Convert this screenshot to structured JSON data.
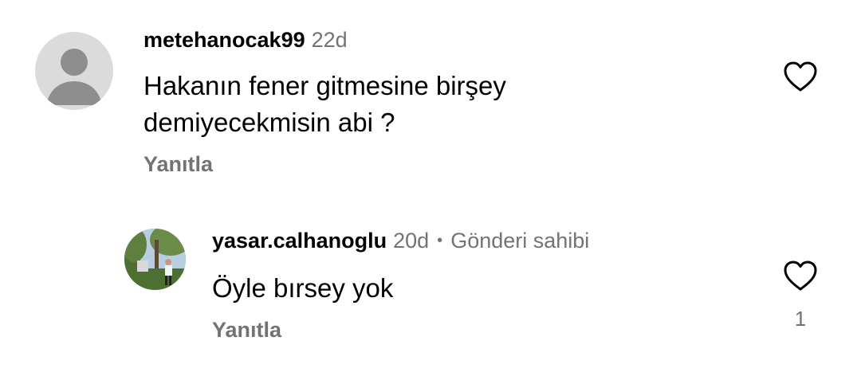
{
  "comments": [
    {
      "username": "metehanocak99",
      "age": "22d",
      "text_lines": [
        "Hakanın fener gitmesine birşey",
        "demiyecekmisin abi ?"
      ],
      "reply_label": "Yanıtla",
      "avatar_icon": "default-user-avatar-icon",
      "like_icon": "heart-outline-icon",
      "like_count": ""
    },
    {
      "username": "yasar.calhanoglu",
      "age": "20d",
      "separator": "•",
      "owner_label": "Gönderi sahibi",
      "text_lines": [
        "Öyle bırsey yok"
      ],
      "reply_label": "Yanıtla",
      "avatar_icon": "user-photo-avatar",
      "like_icon": "heart-outline-icon",
      "like_count": "1"
    }
  ],
  "colors": {
    "primary_text": "#000000",
    "secondary_text": "#737373",
    "avatar_placeholder_bg": "#dbdbdb",
    "avatar_placeholder_fg": "#8e8e8e"
  }
}
